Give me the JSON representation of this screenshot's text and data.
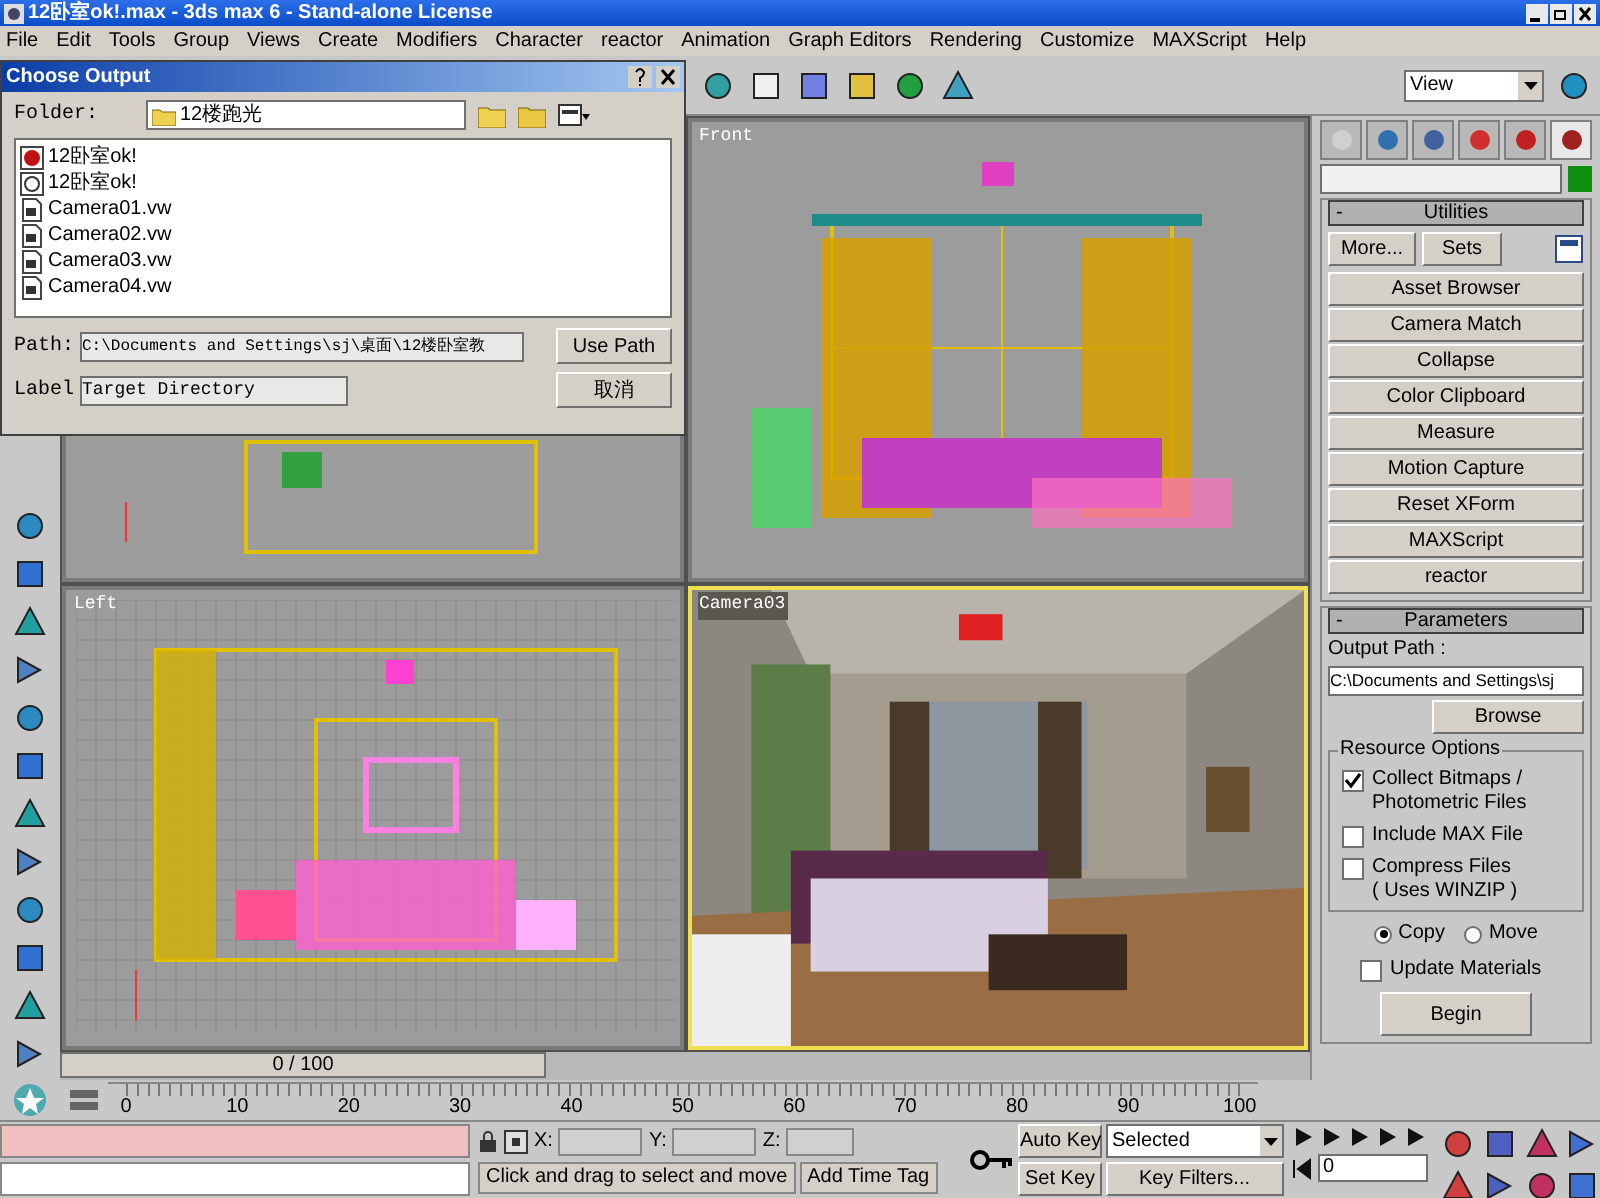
{
  "window": {
    "title": "12卧室ok!.max - 3ds max 6 - Stand-alone License"
  },
  "menu": [
    "File",
    "Edit",
    "Tools",
    "Group",
    "Views",
    "Create",
    "Modifiers",
    "Character",
    "reactor",
    "Animation",
    "Graph Editors",
    "Rendering",
    "Customize",
    "MAXScript",
    "Help"
  ],
  "toolbar": {
    "coord_system": "View"
  },
  "viewports": [
    {
      "kind": "top"
    },
    {
      "kind": "front",
      "label": "Front",
      "active": false
    },
    {
      "kind": "left",
      "label": "Left",
      "active": false
    },
    {
      "kind": "camera",
      "label": "Camera03",
      "active": true
    }
  ],
  "dialog": {
    "title": "Choose Output",
    "folder_label": "Folder:",
    "folder": "12楼跑光",
    "files": [
      {
        "name": "12卧室ok!",
        "kind": "max"
      },
      {
        "name": "12卧室ok!",
        "kind": "render"
      },
      {
        "name": "Camera01.vw",
        "kind": "view"
      },
      {
        "name": "Camera02.vw",
        "kind": "view"
      },
      {
        "name": "Camera03.vw",
        "kind": "view"
      },
      {
        "name": "Camera04.vw",
        "kind": "view"
      }
    ],
    "path_label": "Path:",
    "path": "C:\\Documents and Settings\\sj\\桌面\\12楼卧室教",
    "label_label": "Label",
    "label_value": "Target Directory",
    "use_path": "Use Path",
    "cancel": "取消"
  },
  "command_panel": {
    "tabs": [
      {
        "selected": false
      },
      {
        "selected": false
      },
      {
        "selected": false
      },
      {
        "selected": false
      },
      {
        "selected": false
      },
      {
        "selected": true
      }
    ],
    "utilities_toggle": "-",
    "utilities_title": "Utilities",
    "more": "More...",
    "sets": "Sets",
    "utilities": [
      "Asset Browser",
      "Camera Match",
      "Collapse",
      "Color Clipboard",
      "Measure",
      "Motion Capture",
      "Reset XForm",
      "MAXScript",
      "reactor"
    ],
    "parameters_toggle": "-",
    "parameters_title": "Parameters",
    "output_path_label": "Output Path :",
    "output_path": "C:\\Documents and Settings\\sj",
    "browse": "Browse",
    "resource_title": "Resource Options",
    "options": [
      {
        "lines": [
          "Collect Bitmaps /",
          "Photometric Files"
        ],
        "checked": true
      },
      {
        "lines": [
          "Include MAX File"
        ],
        "checked": false
      },
      {
        "lines": [
          "Compress Files",
          "( Uses WINZIP )"
        ],
        "checked": false
      }
    ],
    "radios": [
      {
        "label": "Copy",
        "selected": true
      },
      {
        "label": "Move",
        "selected": false
      }
    ],
    "update_materials": {
      "label": "Update Materials",
      "checked": false
    },
    "begin": "Begin"
  },
  "timeline": {
    "frame": "0 / 100",
    "level": 0,
    "ticks": [
      "0",
      "10",
      "20",
      "30",
      "40",
      "50",
      "60",
      "70",
      "80",
      "90",
      "100"
    ]
  },
  "status": {
    "prompt": "Click and drag to select and move",
    "time_tag": "Add Time Tag",
    "x_label": "X:",
    "y_label": "Y:",
    "z_label": "Z:",
    "auto_key": "Auto Key",
    "set_key": "Set Key",
    "key_mode": "Selected",
    "key_filters": "Key Filters...",
    "frame": "0"
  }
}
